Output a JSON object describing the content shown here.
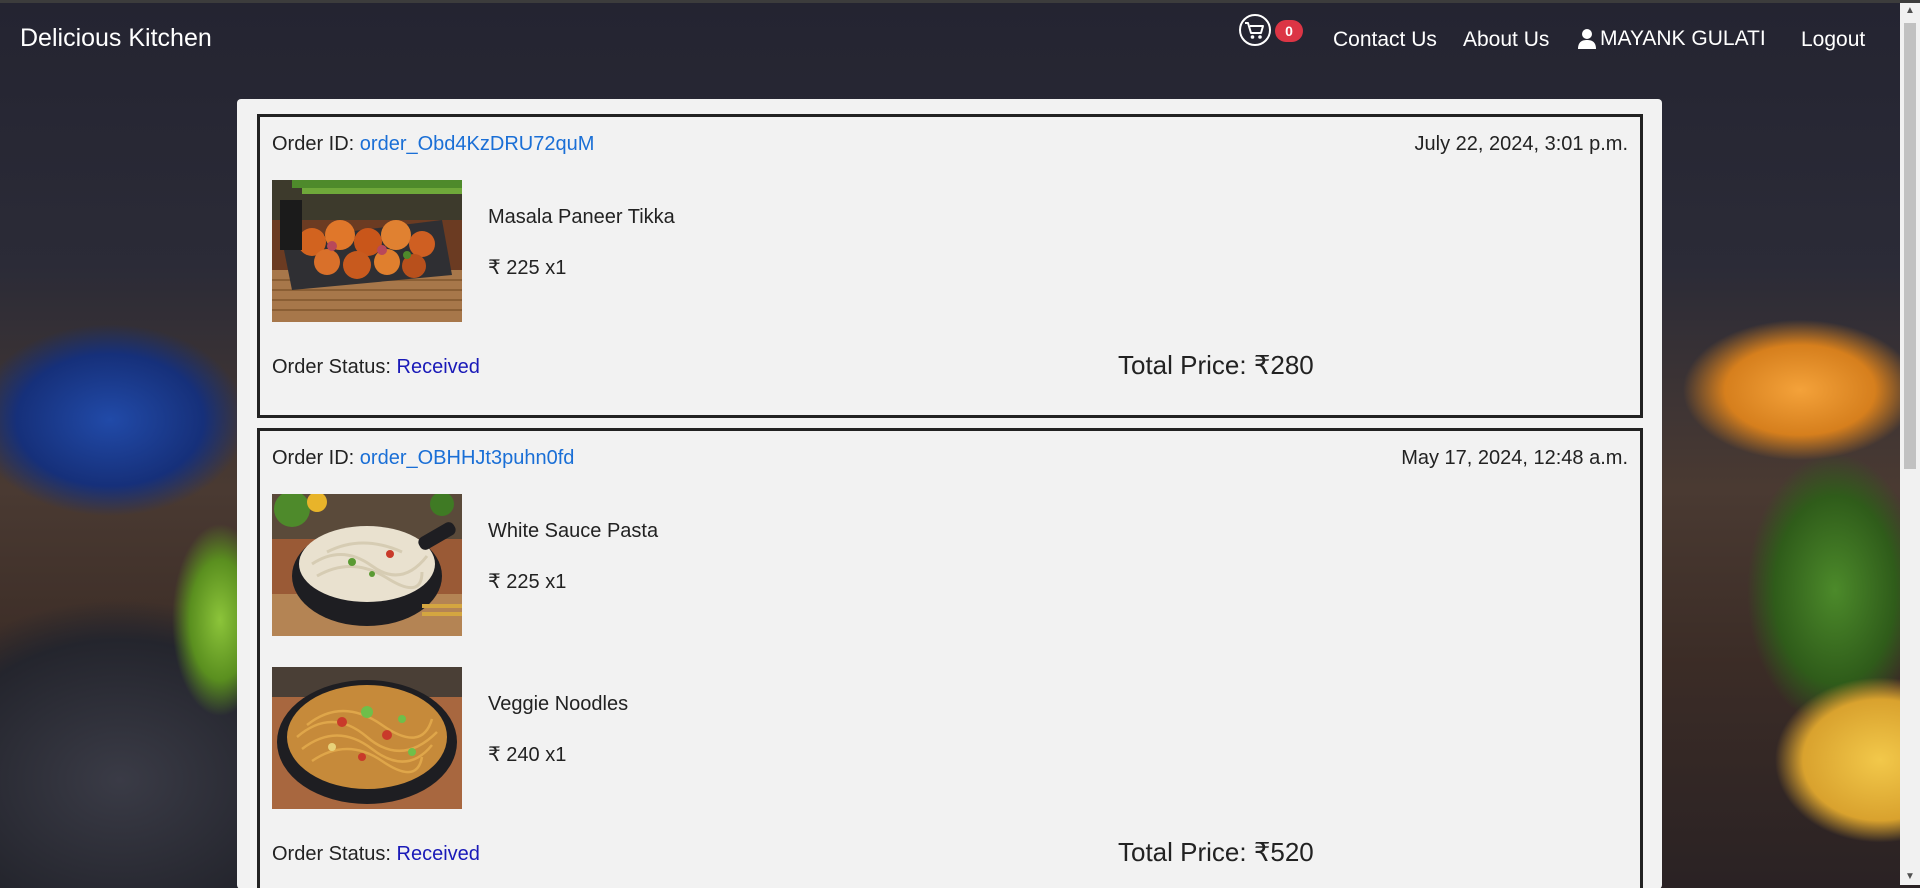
{
  "navbar": {
    "brand": "Delicious Kitchen",
    "cart_count": "0",
    "contact": "Contact Us",
    "about": "About Us",
    "user": "MAYANK GULATI",
    "logout": "Logout"
  },
  "orders": [
    {
      "id_label": "Order ID: ",
      "id": "order_Obd4KzDRU72quM",
      "date": "July 22, 2024, 3:01 p.m.",
      "items": [
        {
          "name": "Masala Paneer Tikka",
          "price": "₹ 225 x1"
        }
      ],
      "status_label": "Order Status: ",
      "status": "Received",
      "total": "Total Price: ₹280"
    },
    {
      "id_label": "Order ID: ",
      "id": "order_OBHHJt3puhn0fd",
      "date": "May 17, 2024, 12:48 a.m.",
      "items": [
        {
          "name": "White Sauce Pasta",
          "price": "₹ 225 x1"
        },
        {
          "name": "Veggie Noodles",
          "price": "₹ 240 x1"
        }
      ],
      "status_label": "Order Status: ",
      "status": "Received",
      "total": "Total Price: ₹520"
    }
  ],
  "colors": {
    "link": "#1a6fd6",
    "status": "#1a1ab8",
    "badge": "#dc3545"
  }
}
